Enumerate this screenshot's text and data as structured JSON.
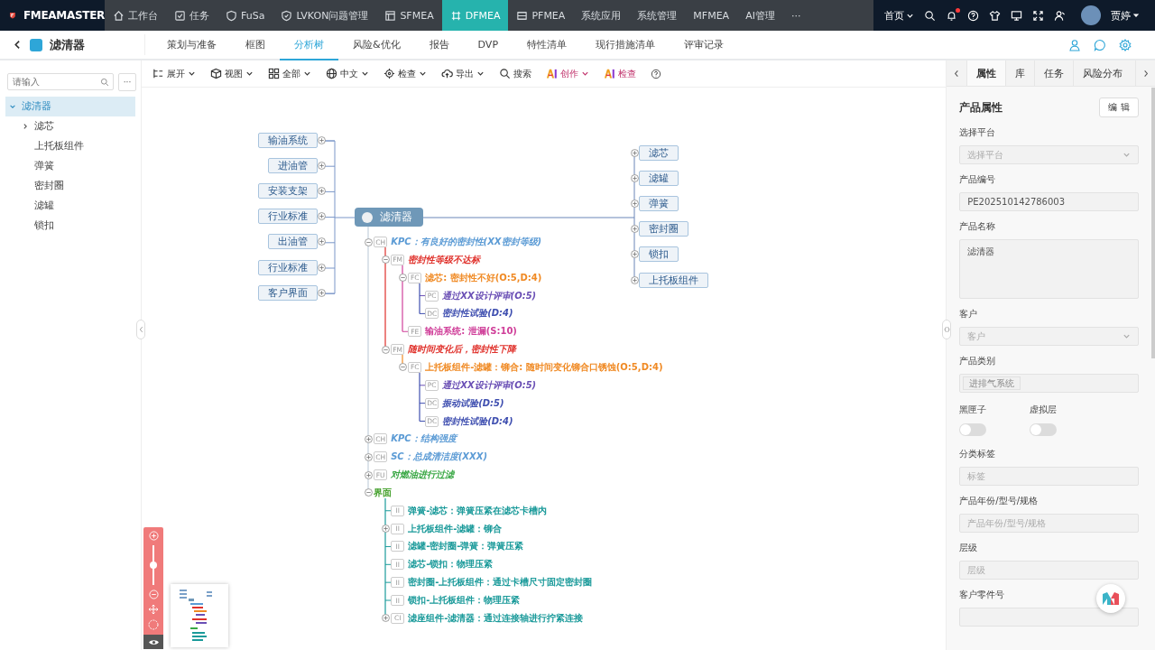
{
  "top_nav": {
    "logo": "FMEAMASTER",
    "tabs": [
      {
        "label": "工作台",
        "selected": false
      },
      {
        "label": "任务",
        "selected": false
      },
      {
        "label": "FuSa",
        "selected": false
      },
      {
        "label": "LVKON问题管理",
        "selected": false
      },
      {
        "label": "SFMEA",
        "selected": false
      },
      {
        "label": "DFMEA",
        "selected": true
      },
      {
        "label": "PFMEA",
        "selected": false
      },
      {
        "label": "系统应用",
        "selected": false
      },
      {
        "label": "系统管理",
        "selected": false
      },
      {
        "label": "MFMEA",
        "selected": false
      },
      {
        "label": "AI管理",
        "selected": false
      },
      {
        "label": "···",
        "selected": false
      }
    ],
    "home_menu": "首页",
    "user": "贾婷"
  },
  "sub_nav": {
    "title": "滤清器",
    "tabs": [
      {
        "label": "策划与准备",
        "selected": false
      },
      {
        "label": "框图",
        "selected": false
      },
      {
        "label": "分析树",
        "selected": true
      },
      {
        "label": "风险&优化",
        "selected": false
      },
      {
        "label": "报告",
        "selected": false
      },
      {
        "label": "DVP",
        "selected": false
      },
      {
        "label": "特性清单",
        "selected": false
      },
      {
        "label": "现行措施清单",
        "selected": false
      },
      {
        "label": "评审记录",
        "selected": false
      }
    ]
  },
  "sidebar": {
    "search": {
      "placeholder": "请输入"
    },
    "more_button": "···",
    "tree": [
      {
        "label": "滤清器",
        "expanded": true,
        "selected": true,
        "children": [
          {
            "label": "滤芯",
            "expanded": false,
            "selected": false
          },
          {
            "label": "上托板组件",
            "selected": false
          },
          {
            "label": "弹簧",
            "selected": false
          },
          {
            "label": "密封圈",
            "selected": false
          },
          {
            "label": "滤罐",
            "selected": false
          },
          {
            "label": "锁扣",
            "selected": false
          }
        ]
      }
    ]
  },
  "toolbar": {
    "items": [
      {
        "label": "展开",
        "dropdown": true
      },
      {
        "label": "视图",
        "dropdown": true
      },
      {
        "label": "全部",
        "dropdown": true
      },
      {
        "label": "中文",
        "dropdown": true
      },
      {
        "label": "检查",
        "dropdown": true
      },
      {
        "label": "导出",
        "dropdown": true
      },
      {
        "label": "搜索",
        "dropdown": false
      },
      {
        "label": "创作",
        "dropdown": true
      },
      {
        "label": "检查",
        "dropdown": false
      }
    ]
  },
  "mind_map": {
    "root": "滤清器",
    "left": [
      "输油系统",
      "进油管",
      "安装支架",
      "行业标准",
      "出油管",
      "行业标准",
      "客户界面"
    ],
    "right": [
      "滤芯",
      "滤罐",
      "弹簧",
      "密封圈",
      "锁扣",
      "上托板组件"
    ],
    "tree": [
      {
        "tag": "CH",
        "text": "KPC：有良好的密封性(XX密封等级)",
        "color": "#5b9bd5",
        "italic": true,
        "expanded": true,
        "children": [
          {
            "tag": "FM",
            "text": "密封性等级不达标",
            "color": "#e0302a",
            "italic": true,
            "expanded": true,
            "children": [
              {
                "tag": "FC",
                "text": "滤芯: 密封性不好(O:5,D:4)",
                "color": "#f08a24",
                "italic": false,
                "expanded": true,
                "children": [
                  {
                    "tag": "PC",
                    "text": "通过XX设计评审(O:5)",
                    "color": "#6a4fb5",
                    "italic": true
                  },
                  {
                    "tag": "DC",
                    "text": "密封性试验(D:4)",
                    "color": "#3f4fb0",
                    "italic": true
                  }
                ]
              },
              {
                "tag": "FE",
                "text": "输油系统: 泄漏(S:10)",
                "color": "#d0409a",
                "italic": false
              }
            ]
          },
          {
            "tag": "FM",
            "text": "随时间变化后，密封性下降",
            "color": "#e0302a",
            "italic": true,
            "expanded": true,
            "children": [
              {
                "tag": "FC",
                "text": "上托板组件-滤罐：铆合: 随时间变化铆合口锈蚀(O:5,D:4)",
                "color": "#f08a24",
                "italic": false,
                "expanded": true,
                "children": [
                  {
                    "tag": "PC",
                    "text": "通过XX设计评审(O:5)",
                    "color": "#6a4fb5",
                    "italic": true
                  },
                  {
                    "tag": "DC",
                    "text": "振动试验(D:5)",
                    "color": "#3f4fb0",
                    "italic": true
                  },
                  {
                    "tag": "DC",
                    "text": "密封性试验(D:4)",
                    "color": "#3f4fb0",
                    "italic": true
                  }
                ]
              }
            ]
          }
        ]
      },
      {
        "tag": "CH",
        "text": "KPC：结构强度",
        "color": "#5b9bd5",
        "italic": true,
        "expanded": false
      },
      {
        "tag": "CH",
        "text": "SC：总成清洁度(XXX)",
        "color": "#5b9bd5",
        "italic": true,
        "expanded": false
      },
      {
        "tag": "FU",
        "text": "对燃油进行过滤",
        "color": "#3aa845",
        "italic": true,
        "expanded": false
      },
      {
        "text": "界面",
        "color": "#44a02c",
        "italic": false,
        "expanded": true,
        "children": [
          {
            "tag": "II",
            "text": "弹簧-滤芯：弹簧压紧在滤芯卡槽内",
            "color": "#1a9a9a",
            "italic": false
          },
          {
            "tag": "II",
            "text": "上托板组件-滤罐：铆合",
            "color": "#1a9a9a",
            "italic": false,
            "expanded": false
          },
          {
            "tag": "II",
            "text": "滤罐-密封圈-弹簧：弹簧压紧",
            "color": "#1a9a9a",
            "italic": false
          },
          {
            "tag": "II",
            "text": "滤芯-锁扣：物理压紧",
            "color": "#1a9a9a",
            "italic": false
          },
          {
            "tag": "II",
            "text": "密封圈-上托板组件：通过卡槽尺寸固定密封圈",
            "color": "#1a9a9a",
            "italic": false
          },
          {
            "tag": "II",
            "text": "锁扣-上托板组件：物理压紧",
            "color": "#1a9a9a",
            "italic": false
          },
          {
            "tag": "CI",
            "text": "滤座组件-滤清器：通过连接轴进行拧紧连接",
            "color": "#1a9a9a",
            "italic": false,
            "expanded": false
          }
        ]
      }
    ]
  },
  "zoom": {
    "level": 0.5
  },
  "right_panel": {
    "tabs": [
      {
        "label": "属性",
        "selected": true
      },
      {
        "label": "库",
        "selected": false
      },
      {
        "label": "任务",
        "selected": false
      },
      {
        "label": "风险分布",
        "selected": false
      }
    ],
    "section_title": "产品属性",
    "edit_button": "编 辑",
    "fields": [
      {
        "kind": "select",
        "label": "选择平台",
        "placeholder": "选择平台"
      },
      {
        "kind": "text",
        "label": "产品编号",
        "value": "PE202510142786003"
      },
      {
        "kind": "textarea",
        "label": "产品名称",
        "value": "滤清器"
      },
      {
        "kind": "select",
        "label": "客户",
        "placeholder": "客户"
      },
      {
        "kind": "tags",
        "label": "产品类别",
        "tags": [
          "进排气系统"
        ]
      },
      {
        "kind": "switches",
        "switches": [
          {
            "label": "黑匣子",
            "on": false
          },
          {
            "label": "虚拟层",
            "on": false
          }
        ]
      },
      {
        "kind": "text",
        "label": "分类标签",
        "placeholder": "标签"
      },
      {
        "kind": "text",
        "label": "产品年份/型号/规格",
        "placeholder": "产品年份/型号/规格"
      },
      {
        "kind": "text",
        "label": "层级",
        "placeholder": "层级"
      },
      {
        "kind": "text",
        "label": "客户零件号"
      }
    ]
  }
}
